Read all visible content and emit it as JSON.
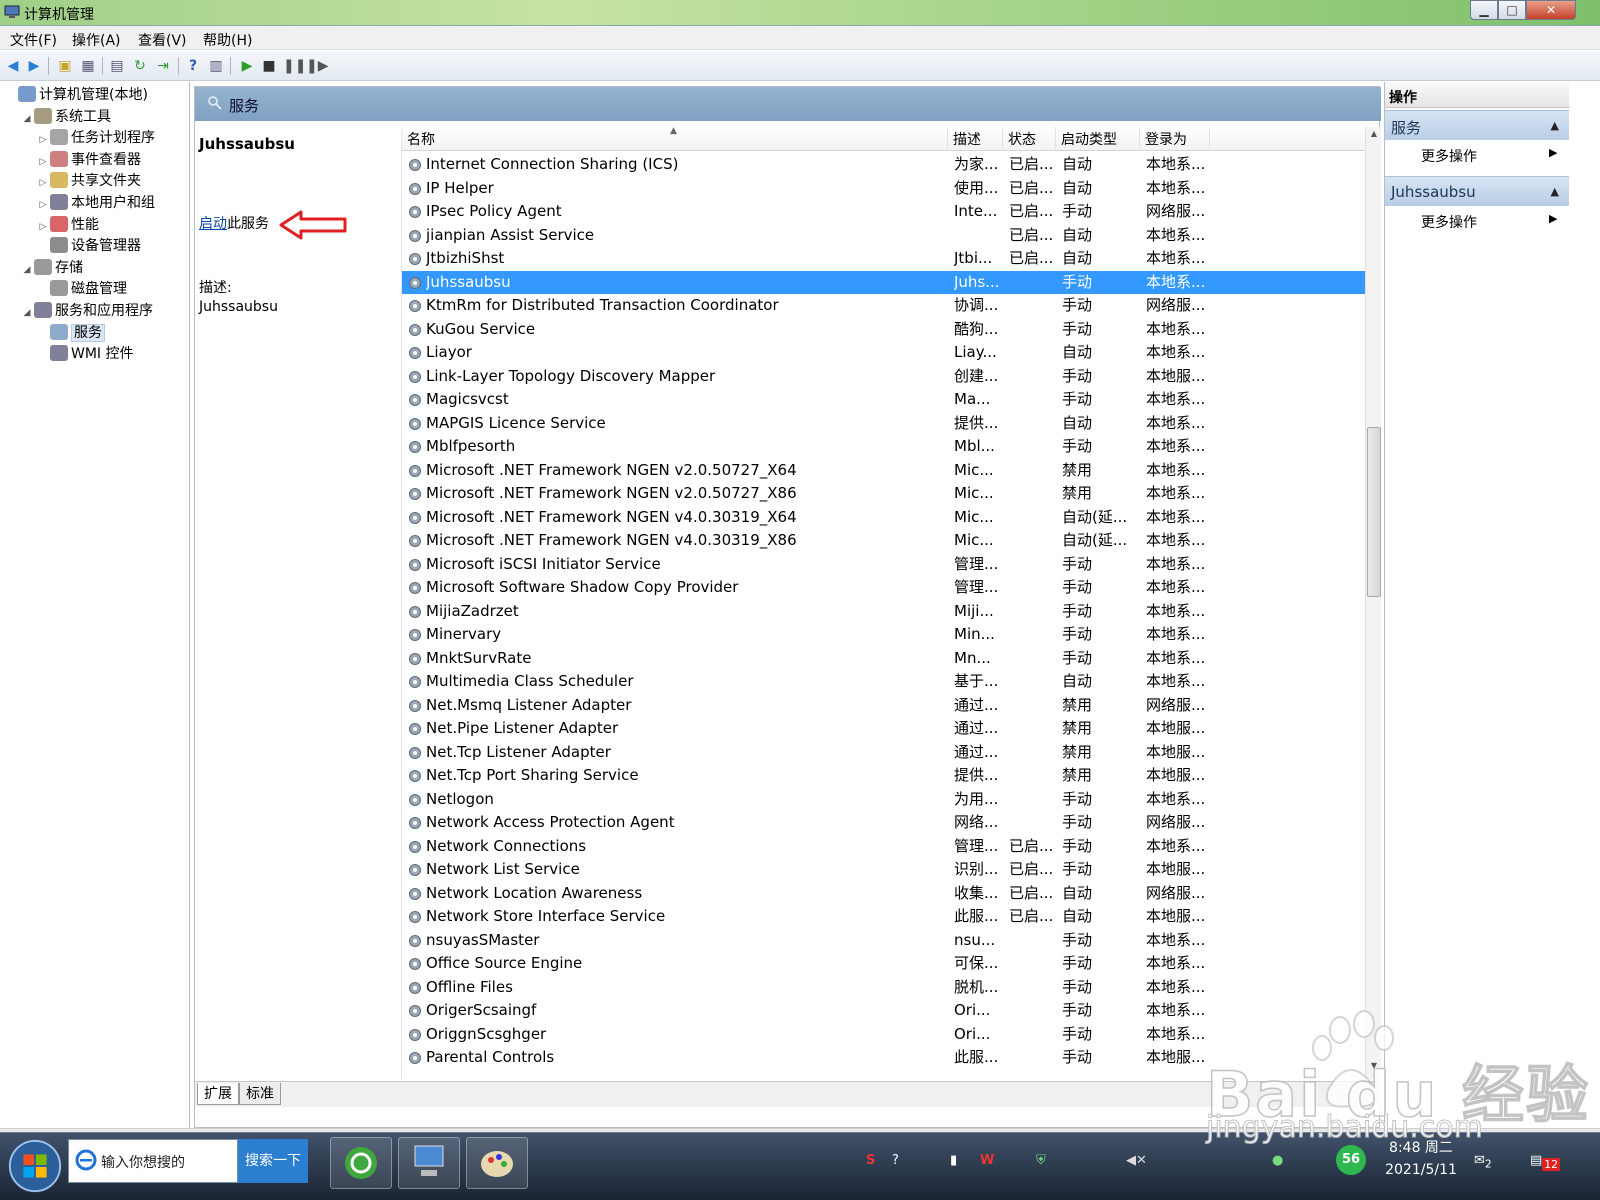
{
  "window": {
    "title": "计算机管理",
    "min_label": "▁",
    "max_label": "□",
    "close_label": "✕"
  },
  "menu": [
    "文件(F)",
    "操作(A)",
    "查看(V)",
    "帮助(H)"
  ],
  "tree": [
    {
      "label": "计算机管理(本地)",
      "icon": "computer-icon",
      "level": 0,
      "twisty": ""
    },
    {
      "label": "系统工具",
      "icon": "tools-icon",
      "level": 1,
      "twisty": "◢"
    },
    {
      "label": "任务计划程序",
      "icon": "clock-icon",
      "level": 2,
      "twisty": "▷"
    },
    {
      "label": "事件查看器",
      "icon": "event-viewer-icon",
      "level": 2,
      "twisty": "▷"
    },
    {
      "label": "共享文件夹",
      "icon": "shared-folder-icon",
      "level": 2,
      "twisty": "▷"
    },
    {
      "label": "本地用户和组",
      "icon": "users-icon",
      "level": 2,
      "twisty": "▷"
    },
    {
      "label": "性能",
      "icon": "performance-icon",
      "level": 2,
      "twisty": "▷"
    },
    {
      "label": "设备管理器",
      "icon": "device-manager-icon",
      "level": 2,
      "twisty": ""
    },
    {
      "label": "存储",
      "icon": "storage-icon",
      "level": 1,
      "twisty": "◢"
    },
    {
      "label": "磁盘管理",
      "icon": "disk-icon",
      "level": 2,
      "twisty": ""
    },
    {
      "label": "服务和应用程序",
      "icon": "services-apps-icon",
      "level": 1,
      "twisty": "◢"
    },
    {
      "label": "服务",
      "icon": "services-icon",
      "level": 2,
      "twisty": "",
      "selected": true
    },
    {
      "label": "WMI 控件",
      "icon": "wmi-icon",
      "level": 2,
      "twisty": ""
    }
  ],
  "services_header": "服务",
  "extended": {
    "name": "Juhssaubsu",
    "action_link": "启动",
    "action_rest": "此服务",
    "desc_label": "描述:",
    "desc_value": "Juhssaubsu"
  },
  "columns": [
    "名称",
    "描述",
    "状态",
    "启动类型",
    "登录为"
  ],
  "rows": [
    [
      "Internet Connection Sharing (ICS)",
      "为家...",
      "已启...",
      "自动",
      "本地系..."
    ],
    [
      "IP Helper",
      "使用...",
      "已启...",
      "自动",
      "本地系..."
    ],
    [
      "IPsec Policy Agent",
      "Inte...",
      "已启...",
      "手动",
      "网络服..."
    ],
    [
      "jianpian Assist Service",
      "",
      "已启...",
      "自动",
      "本地系..."
    ],
    [
      "JtbizhiShst",
      "Jtbi...",
      "已启...",
      "自动",
      "本地系..."
    ],
    [
      "Juhssaubsu",
      "Juhs...",
      "",
      "手动",
      "本地系..."
    ],
    [
      "KtmRm for Distributed Transaction Coordinator",
      "协调...",
      "",
      "手动",
      "网络服..."
    ],
    [
      "KuGou Service",
      "酷狗...",
      "",
      "手动",
      "本地系..."
    ],
    [
      "Liayor",
      "Liay...",
      "",
      "自动",
      "本地系..."
    ],
    [
      "Link-Layer Topology Discovery Mapper",
      "创建...",
      "",
      "手动",
      "本地服..."
    ],
    [
      "Magicsvcst",
      "Ma...",
      "",
      "手动",
      "本地系..."
    ],
    [
      "MAPGIS Licence Service",
      "提供...",
      "",
      "自动",
      "本地系..."
    ],
    [
      "Mblfpesorth",
      "Mbl...",
      "",
      "手动",
      "本地系..."
    ],
    [
      "Microsoft .NET Framework NGEN v2.0.50727_X64",
      "Mic...",
      "",
      "禁用",
      "本地系..."
    ],
    [
      "Microsoft .NET Framework NGEN v2.0.50727_X86",
      "Mic...",
      "",
      "禁用",
      "本地系..."
    ],
    [
      "Microsoft .NET Framework NGEN v4.0.30319_X64",
      "Mic...",
      "",
      "自动(延...",
      "本地系..."
    ],
    [
      "Microsoft .NET Framework NGEN v4.0.30319_X86",
      "Mic...",
      "",
      "自动(延...",
      "本地系..."
    ],
    [
      "Microsoft iSCSI Initiator Service",
      "管理...",
      "",
      "手动",
      "本地系..."
    ],
    [
      "Microsoft Software Shadow Copy Provider",
      "管理...",
      "",
      "手动",
      "本地系..."
    ],
    [
      "MijiaZadrzet",
      "Miji...",
      "",
      "手动",
      "本地系..."
    ],
    [
      "Minervary",
      "Min...",
      "",
      "手动",
      "本地系..."
    ],
    [
      "MnktSurvRate",
      "Mn...",
      "",
      "手动",
      "本地系..."
    ],
    [
      "Multimedia Class Scheduler",
      "基于...",
      "",
      "自动",
      "本地系..."
    ],
    [
      "Net.Msmq Listener Adapter",
      "通过...",
      "",
      "禁用",
      "网络服..."
    ],
    [
      "Net.Pipe Listener Adapter",
      "通过...",
      "",
      "禁用",
      "本地服..."
    ],
    [
      "Net.Tcp Listener Adapter",
      "通过...",
      "",
      "禁用",
      "本地服..."
    ],
    [
      "Net.Tcp Port Sharing Service",
      "提供...",
      "",
      "禁用",
      "本地服..."
    ],
    [
      "Netlogon",
      "为用...",
      "",
      "手动",
      "本地系..."
    ],
    [
      "Network Access Protection Agent",
      "网络...",
      "",
      "手动",
      "网络服..."
    ],
    [
      "Network Connections",
      "管理...",
      "已启...",
      "手动",
      "本地系..."
    ],
    [
      "Network List Service",
      "识别...",
      "已启...",
      "手动",
      "本地服..."
    ],
    [
      "Network Location Awareness",
      "收集...",
      "已启...",
      "自动",
      "网络服..."
    ],
    [
      "Network Store Interface Service",
      "此服...",
      "已启...",
      "自动",
      "本地服..."
    ],
    [
      "nsuyasSMaster",
      "nsu...",
      "",
      "手动",
      "本地系..."
    ],
    [
      "Office Source Engine",
      "可保...",
      "",
      "手动",
      "本地系..."
    ],
    [
      "Offline Files",
      "脱机...",
      "",
      "手动",
      "本地系..."
    ],
    [
      "OrigerScsaingf",
      "Ori...",
      "",
      "手动",
      "本地系..."
    ],
    [
      "OriggnScsghger",
      "Ori...",
      "",
      "手动",
      "本地系..."
    ],
    [
      "Parental Controls",
      "此服...",
      "",
      "手动",
      "本地服..."
    ]
  ],
  "selected_row": 5,
  "tabs": [
    "扩展",
    "标准"
  ],
  "actions": {
    "header": "操作",
    "sections": [
      {
        "title": "服务",
        "item": "更多操作"
      },
      {
        "title": "Juhssaubsu",
        "item": "更多操作"
      }
    ]
  },
  "taskbar": {
    "search_placeholder": "输入你想搜的",
    "search_button": "搜索一下",
    "time": "8:48 周二",
    "date": "2021/5/11",
    "badge_value": "56",
    "notif_count": "2",
    "action_center_count": "12"
  },
  "watermark": {
    "brand": "Bai du 经验",
    "url": "jingyan.baidu.com"
  },
  "colors": {
    "selected_row": "#3399ff",
    "link": "#0645ad",
    "annotation_arrow": "#e02020"
  }
}
